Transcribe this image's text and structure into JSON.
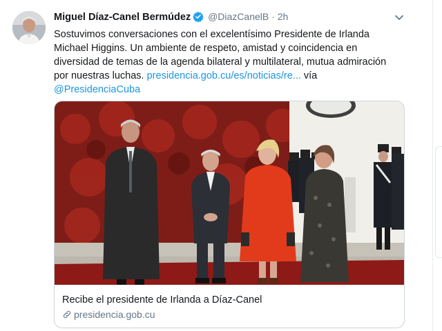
{
  "tweet": {
    "author_name": "Miguel Díaz-Canel Bermúdez",
    "handle": "@DiazCanelB",
    "separator": "·",
    "time": "2h",
    "text_lines": [
      "Sostuvimos conversaciones con el excelentísimo Presidente de Irlanda",
      "Michael Higgins. Un ambiente de respeto, amistad y coincidencia en",
      "diversidad de temas de la agenda bilateral y multilateral, mutua admiración"
    ],
    "text_last_prefix": "por nuestras luchas. ",
    "link_text": "presidencia.gob.cu/es/noticias/re...",
    "via_text": " vía",
    "via_handle": "@PresidenciaCuba"
  },
  "card": {
    "title": "Recibe el presidente de Irlanda a Díaz-Canel",
    "domain": "presidencia.gob.cu"
  },
  "icons": [
    "verified-badge-icon",
    "chevron-down-icon",
    "link-icon"
  ],
  "colors": {
    "text": "#14171a",
    "muted": "#657786",
    "link": "#1b95e0",
    "border": "#ccd6dd",
    "verified": "#1da1f2"
  }
}
